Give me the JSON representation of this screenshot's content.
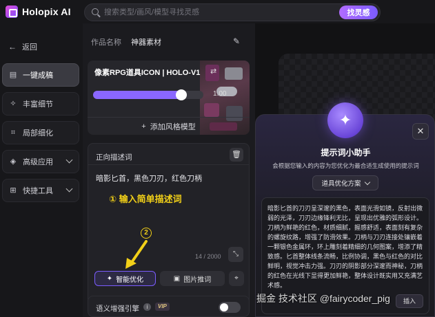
{
  "app": {
    "name": "Holopix AI"
  },
  "search": {
    "placeholder": "搜索类型/画风/模型寻找灵感",
    "button": "找灵感"
  },
  "sidebar": {
    "back": "返回",
    "items": [
      {
        "label": "一键成稿",
        "icon": "layers-icon",
        "active": true
      },
      {
        "label": "丰富细节",
        "icon": "magic-icon"
      },
      {
        "label": "局部细化",
        "icon": "brush-icon"
      },
      {
        "label": "高级应用",
        "icon": "grid-icon",
        "expandable": true
      },
      {
        "label": "快捷工具",
        "icon": "tools-icon",
        "expandable": true
      }
    ]
  },
  "work": {
    "label": "作品名称",
    "name": "神器素材"
  },
  "model": {
    "title": "像素RPG道具ICON | HOLO-V1",
    "weight": 0.8,
    "weight_text": "1.00",
    "add_style": "添加风格模型"
  },
  "prompt": {
    "header": "正向描述词",
    "text": "暗影匕首，黑色刀刃，红色刀柄",
    "annotation1": "① 输入简单描述词",
    "annotation2": "2",
    "count": "14 / 2000",
    "optimize": "智能优化",
    "image_prompt": "图片推词"
  },
  "semantic": {
    "label": "语义增强引擎",
    "badge": "VIP"
  },
  "assistant": {
    "title": "提示词小助手",
    "subtitle": "会根据您输入的内容为您优化为最合适生成使用的提示词",
    "scheme": "道具优化方案",
    "result": "暗影匕首的刀刃呈深邃的黑色，表面光滑如镜，反射出微弱的光泽，刀刃边缘锋利无比，呈现出优雅的弧形设计。刀柄为鲜艳的红色，材质细腻，握感舒适，表面刻有复杂的螺旋纹路，增强了防滑效果。刀柄与刀刃连接处镶嵌着一颗银色金属环，环上雕刻着精细的几何图案，增添了精致感。匕首整体线条流畅，比例协调，黑色与红色的对比鲜明，视觉冲击力强。刀刃的阴影部分深邃而神秘，刀柄的红色在光线下显得更加鲜艳，整体设计既实用又充满艺术感。",
    "insert": "插入"
  },
  "watermark": "掘金 技术社区 @fairycoder_pig",
  "colors": {
    "accent": "#8a67ff",
    "annotation": "#f2d018"
  }
}
